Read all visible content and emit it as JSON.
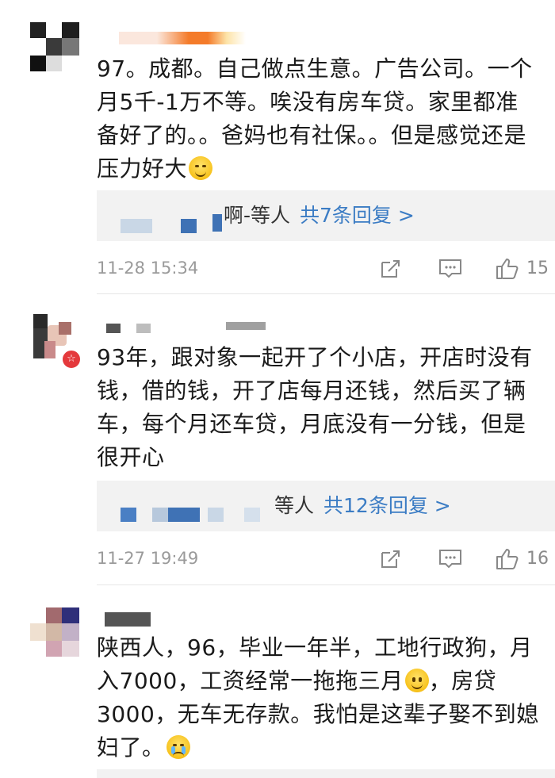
{
  "comments": [
    {
      "text": "97。成都。自己做点生意。广告公司。一个月5千-1万不等。唉没有房车贷。家里都准备好了的。。爸妈也有社保。。但是感觉还是压力好大",
      "emoji": "sweat-smile-emoji",
      "reply_prefix": "啊-等人",
      "reply_link": "共7条回复 >",
      "time": "11-28 15:34",
      "likes": "15"
    },
    {
      "text": "93年，跟对象一起开了个小店，开店时没有钱，借的钱，开了店每月还钱，然后买了辆车，每个月还车贷，月底没有一分钱，但是很开心",
      "reply_prefix": "等人",
      "reply_link": "共12条回复 >",
      "time": "11-27 19:49",
      "likes": "16"
    },
    {
      "text": "陕西人，96，毕业一年半，工地行政狗，月入7000，工资经常一拖拖三月",
      "text_after_emoji": "，房贷3000，无车无存款。我怕是这辈子娶不到媳妇了。",
      "emoji_1": "smile-emoji",
      "emoji_2": "crying-emoji"
    }
  ]
}
